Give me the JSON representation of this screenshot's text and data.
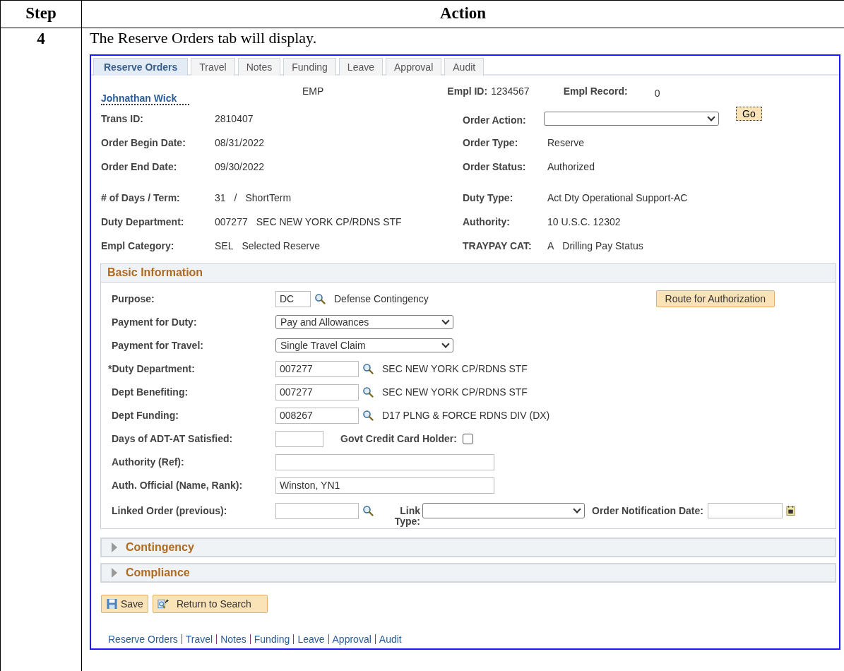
{
  "doc_table": {
    "columns": [
      "Step",
      "Action"
    ],
    "step": "4",
    "instruction": "The Reserve Orders tab will display."
  },
  "tabs": [
    {
      "label": "Reserve Orders",
      "selected": true
    },
    {
      "label": "Travel",
      "selected": false
    },
    {
      "label": "Notes",
      "selected": false
    },
    {
      "label": "Funding",
      "selected": false
    },
    {
      "label": "Leave",
      "selected": false
    },
    {
      "label": "Approval",
      "selected": false
    },
    {
      "label": "Audit",
      "selected": false
    }
  ],
  "header": {
    "name": "Johnathan Wick",
    "emp_type": "EMP",
    "empl_id_label": "Empl ID:",
    "empl_id": "1234567",
    "empl_record_label": "Empl Record:",
    "empl_record": "0",
    "order_action_label": "Order Action:",
    "go_button": "Go",
    "rows": [
      {
        "label": "Trans ID:",
        "values": [
          "2810407"
        ],
        "right_label": "",
        "right_values": []
      },
      {
        "label": "Order Begin Date:",
        "values": [
          "08/31/2022"
        ],
        "right_label": "Order Type:",
        "right_values": [
          "Reserve"
        ]
      },
      {
        "label": "Order End Date:",
        "values": [
          "09/30/2022"
        ],
        "right_label": "Order Status:",
        "right_values": [
          "Authorized"
        ]
      },
      {
        "label": "# of Days / Term:",
        "values": [
          "31",
          "/",
          "ShortTerm"
        ],
        "right_label": "Duty Type:",
        "right_values": [
          "Act Dty Operational Support-AC"
        ]
      },
      {
        "label": "Duty Department:",
        "values": [
          "007277",
          "SEC NEW YORK CP/RDNS STF"
        ],
        "right_label": "Authority:",
        "right_values": [
          "10 U.S.C. 12302"
        ]
      },
      {
        "label": "Empl Category:",
        "values": [
          "SEL",
          "Selected Reserve"
        ],
        "right_label": "TRAYPAY CAT:",
        "right_values": [
          "A",
          "Drilling Pay Status"
        ]
      }
    ]
  },
  "basic_information": {
    "title": "Basic Information",
    "route_button": "Route for Authorization",
    "fields": [
      {
        "kind": "lookup",
        "label": "Purpose:",
        "value": "DC",
        "description": "Defense Contingency"
      },
      {
        "kind": "select",
        "label": "Payment for Duty:",
        "value": "Pay and Allowances"
      },
      {
        "kind": "select",
        "label": "Payment for Travel:",
        "value": "Single Travel Claim"
      },
      {
        "kind": "lookup",
        "label": "*Duty Department:",
        "value": "007277",
        "description": "SEC NEW YORK CP/RDNS STF"
      },
      {
        "kind": "lookup",
        "label": "Dept Benefiting:",
        "value": "007277",
        "description": "SEC NEW YORK CP/RDNS STF"
      },
      {
        "kind": "lookup",
        "label": "Dept Funding:",
        "value": "008267",
        "description": "D17 PLNG & FORCE RDNS DIV (DX)"
      },
      {
        "kind": "pair",
        "label": "Days of ADT-AT Satisfied:",
        "check_label": "Govt Credit Card Holder:",
        "checked": false
      },
      {
        "kind": "text",
        "label": "Authority (Ref):"
      },
      {
        "kind": "text",
        "label": "Auth. Official (Name, Rank):",
        "value": "Winston, YN1"
      },
      {
        "kind": "linked",
        "label": "Linked Order (previous):",
        "link_type_label": "Link Type:",
        "date_label": "Order Notification Date:"
      }
    ]
  },
  "sections": [
    {
      "title": "Contingency",
      "expanded": false
    },
    {
      "title": "Compliance",
      "expanded": false
    }
  ],
  "buttons": [
    {
      "kind": "save",
      "label": "Save"
    },
    {
      "kind": "return",
      "label": "Return to Search"
    }
  ],
  "footer_links": [
    "Reserve Orders",
    "Travel",
    "Notes",
    "Funding",
    "Leave",
    "Approval",
    "Audit"
  ]
}
